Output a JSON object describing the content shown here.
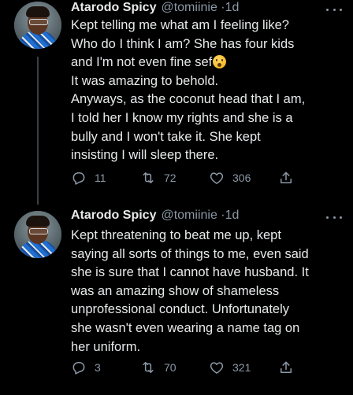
{
  "tweets": [
    {
      "name": "Atarodo Spicy",
      "handle": "@tomiinie",
      "time": "1d",
      "lines": [
        "Kept telling me what am I feeling like?",
        "Who do I think I am? She has four kids",
        "and I'm not even fine sef",
        "It was amazing to behold.",
        "Anyways, as the coconut head that I am,",
        "I told her I know my rights and she is a",
        "bully and I won't take it. She kept",
        "insisting I will sleep there."
      ],
      "emoji": "hushed-face-emoji",
      "replies": "11",
      "retweets": "72",
      "likes": "306"
    },
    {
      "name": "Atarodo Spicy",
      "handle": "@tomiinie",
      "time": "1d",
      "lines": [
        "Kept threatening to beat me up, kept",
        "saying all sorts of things to me, even said",
        "she is sure that I cannot have husband. It",
        "was an amazing show of shameless",
        "unprofessional conduct. Unfortunately",
        "she wasn't even wearing a name tag on",
        "her uniform."
      ],
      "replies": "3",
      "retweets": "70",
      "likes": "321"
    }
  ],
  "separator": "·",
  "icons": {
    "reply": "reply-icon",
    "retweet": "retweet-icon",
    "like": "heart-icon",
    "share": "share-icon",
    "more": "more-options-icon"
  },
  "colors": {
    "background": "#000000",
    "text": "#e7e9ea",
    "muted": "#8b98a5",
    "thread_line": "#3a3f44"
  }
}
